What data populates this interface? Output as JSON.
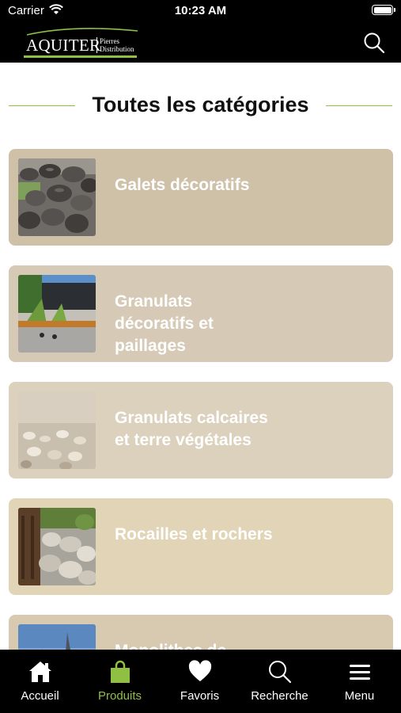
{
  "status_bar": {
    "carrier": "Carrier",
    "time": "10:23 AM"
  },
  "header": {
    "logo": {
      "main": "AQUITER",
      "sub_line1": "Pierres",
      "sub_line2": "Distribution"
    },
    "search_icon": "search-icon"
  },
  "page": {
    "title": "Toutes les catégories"
  },
  "categories": [
    {
      "label": "Galets décoratifs",
      "bg": "#cfc0a8",
      "image": "pebbles"
    },
    {
      "label": "Granulats décoratifs et paillages",
      "bg": "#d6cab7",
      "image": "garden"
    },
    {
      "label": "Granulats calcaires et terre végétales",
      "bg": "#dcd1bd",
      "image": "gravel"
    },
    {
      "label": "Rocailles et rochers",
      "bg": "#e2d4b6",
      "image": "rockery"
    },
    {
      "label": "Monolithes de ...",
      "bg": "#d8cab0",
      "image": "monolith"
    }
  ],
  "tabbar": {
    "tabs": [
      {
        "label": "Accueil",
        "icon": "home-icon"
      },
      {
        "label": "Produits",
        "icon": "bag-icon",
        "active": true
      },
      {
        "label": "Favoris",
        "icon": "heart-icon"
      },
      {
        "label": "Recherche",
        "icon": "search-icon"
      },
      {
        "label": "Menu",
        "icon": "menu-icon"
      }
    ]
  },
  "colors": {
    "accent": "#8fc043",
    "bar": "#000000"
  }
}
